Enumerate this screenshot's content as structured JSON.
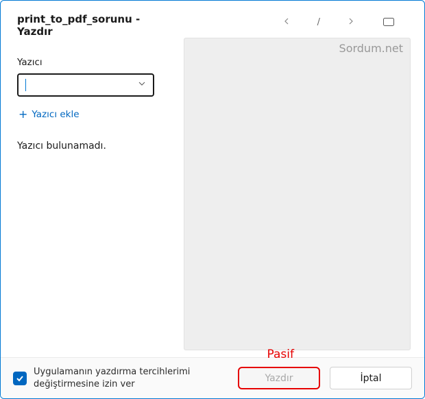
{
  "window": {
    "title": "print_to_pdf_sorunu - Yazdır"
  },
  "printer": {
    "label": "Yazıcı",
    "value": "",
    "add_label": "Yazıcı ekle",
    "status": "Yazıcı bulunamadı."
  },
  "pager": {
    "separator": "/"
  },
  "preview": {
    "watermark": "Sordum.net"
  },
  "annotation": {
    "text": "Pasif"
  },
  "footer": {
    "checkbox_label": "Uygulamanın yazdırma tercihlerimi değiştirmesine izin ver",
    "checkbox_checked": true,
    "print_label": "Yazdır",
    "cancel_label": "İptal"
  }
}
